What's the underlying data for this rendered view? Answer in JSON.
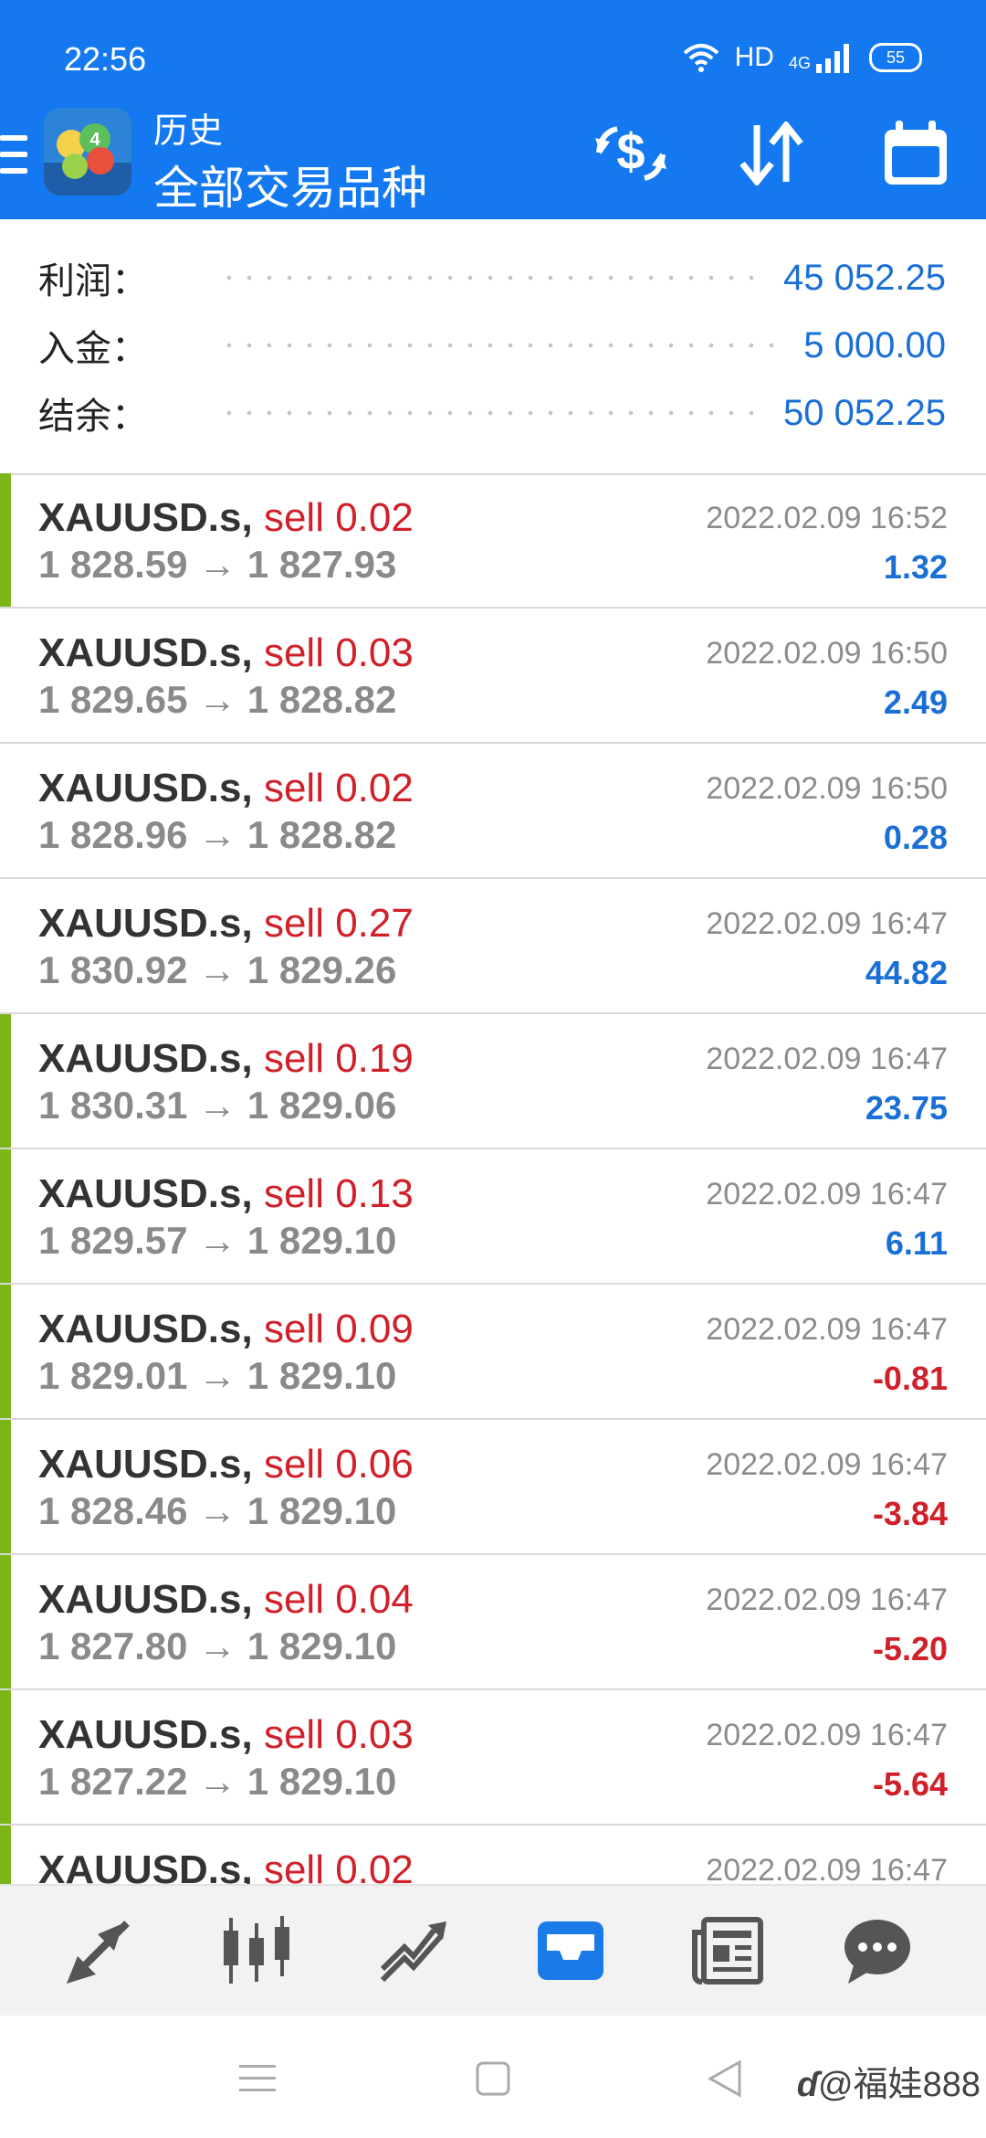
{
  "status_bar": {
    "time": "22:56",
    "hd": "HD",
    "network": "4G",
    "battery": "55"
  },
  "header": {
    "subtitle": "历史",
    "title": "全部交易品种"
  },
  "summary": [
    {
      "label": "利润：",
      "value": "45 052.25"
    },
    {
      "label": "入金：",
      "value": "5 000.00"
    },
    {
      "label": "结余：",
      "value": "50 052.25"
    }
  ],
  "trades": [
    {
      "symbol": "XAUUSD.s,",
      "side": "sell 0.02",
      "open": "1 828.59",
      "close": "1 827.93",
      "time": "2022.02.09 16:52",
      "profit": "1.32",
      "marked": true
    },
    {
      "symbol": "XAUUSD.s,",
      "side": "sell 0.03",
      "open": "1 829.65",
      "close": "1 828.82",
      "time": "2022.02.09 16:50",
      "profit": "2.49",
      "marked": false
    },
    {
      "symbol": "XAUUSD.s,",
      "side": "sell 0.02",
      "open": "1 828.96",
      "close": "1 828.82",
      "time": "2022.02.09 16:50",
      "profit": "0.28",
      "marked": false
    },
    {
      "symbol": "XAUUSD.s,",
      "side": "sell 0.27",
      "open": "1 830.92",
      "close": "1 829.26",
      "time": "2022.02.09 16:47",
      "profit": "44.82",
      "marked": false
    },
    {
      "symbol": "XAUUSD.s,",
      "side": "sell 0.19",
      "open": "1 830.31",
      "close": "1 829.06",
      "time": "2022.02.09 16:47",
      "profit": "23.75",
      "marked": true
    },
    {
      "symbol": "XAUUSD.s,",
      "side": "sell 0.13",
      "open": "1 829.57",
      "close": "1 829.10",
      "time": "2022.02.09 16:47",
      "profit": "6.11",
      "marked": true
    },
    {
      "symbol": "XAUUSD.s,",
      "side": "sell 0.09",
      "open": "1 829.01",
      "close": "1 829.10",
      "time": "2022.02.09 16:47",
      "profit": "-0.81",
      "marked": true
    },
    {
      "symbol": "XAUUSD.s,",
      "side": "sell 0.06",
      "open": "1 828.46",
      "close": "1 829.10",
      "time": "2022.02.09 16:47",
      "profit": "-3.84",
      "marked": true
    },
    {
      "symbol": "XAUUSD.s,",
      "side": "sell 0.04",
      "open": "1 827.80",
      "close": "1 829.10",
      "time": "2022.02.09 16:47",
      "profit": "-5.20",
      "marked": true
    },
    {
      "symbol": "XAUUSD.s,",
      "side": "sell 0.03",
      "open": "1 827.22",
      "close": "1 829.10",
      "time": "2022.02.09 16:47",
      "profit": "-5.64",
      "marked": true
    },
    {
      "symbol": "XAUUSD.s,",
      "side": "sell 0.02",
      "open": "",
      "close": "",
      "time": "2022.02.09 16:47",
      "profit": "",
      "marked": true
    }
  ],
  "colors": {
    "accent": "#1479f0",
    "profit_positive": "#1a6fd6",
    "profit_negative": "#d0202a",
    "side": "#d0202a",
    "marker": "#7cb518"
  },
  "bottom_nav": [
    {
      "name": "quotes-icon",
      "active": false
    },
    {
      "name": "chart-icon",
      "active": false
    },
    {
      "name": "trade-icon",
      "active": false
    },
    {
      "name": "history-icon",
      "active": true
    },
    {
      "name": "news-icon",
      "active": false
    },
    {
      "name": "chat-icon",
      "active": false
    }
  ],
  "watermark": "@福娃888"
}
